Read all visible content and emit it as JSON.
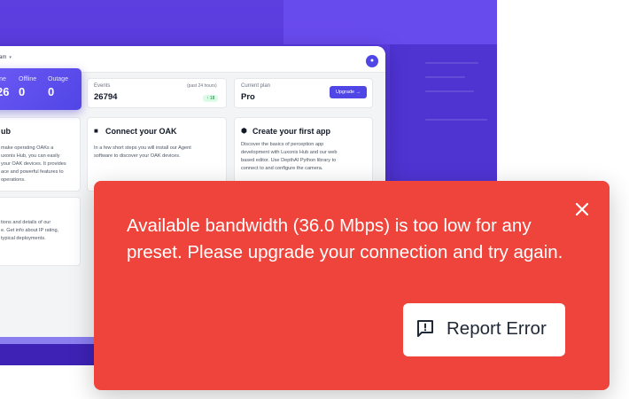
{
  "topbar": {
    "team_label": "team"
  },
  "status": {
    "online_label": "line",
    "online_value": "26",
    "offline_label": "Offline",
    "offline_value": "0",
    "outage_label": "Outage",
    "outage_value": "0"
  },
  "events": {
    "label": "Events",
    "period": "(past 24 hours)",
    "value": "26794",
    "trend": "↑ 18"
  },
  "plan": {
    "label": "Current plan",
    "value": "Pro",
    "upgrade_label": "Upgrade →"
  },
  "hub_card": {
    "title": "ub",
    "text": "make operating OAKs a\nuxonis Hub, you can easily\nyour OAK devices. It provides\nace and powerful features to\noperations."
  },
  "connect_card": {
    "title": "Connect your OAK",
    "text": "In a few short steps you will install our Agent\nsoftware to discover your OAK devices."
  },
  "app_card": {
    "title": "Create your first app",
    "text": "Discover the basics of perception app\ndevelopment with Luxonis Hub and our web\nbased editor. Use DepthAI Python library to\nconnect to and configure the camera."
  },
  "lower_card": {
    "text": "tions and details of our\ne. Get info about IP rating,\ntypical deployments."
  },
  "toast": {
    "message": "Available bandwidth (36.0 Mbps) is too low for any preset. Please upgrade your connection and try again.",
    "report_label": "Report Error",
    "background_color": "#ef443b"
  },
  "colors": {
    "accent": "#4f46e5",
    "backdrop": "#5233d6"
  }
}
